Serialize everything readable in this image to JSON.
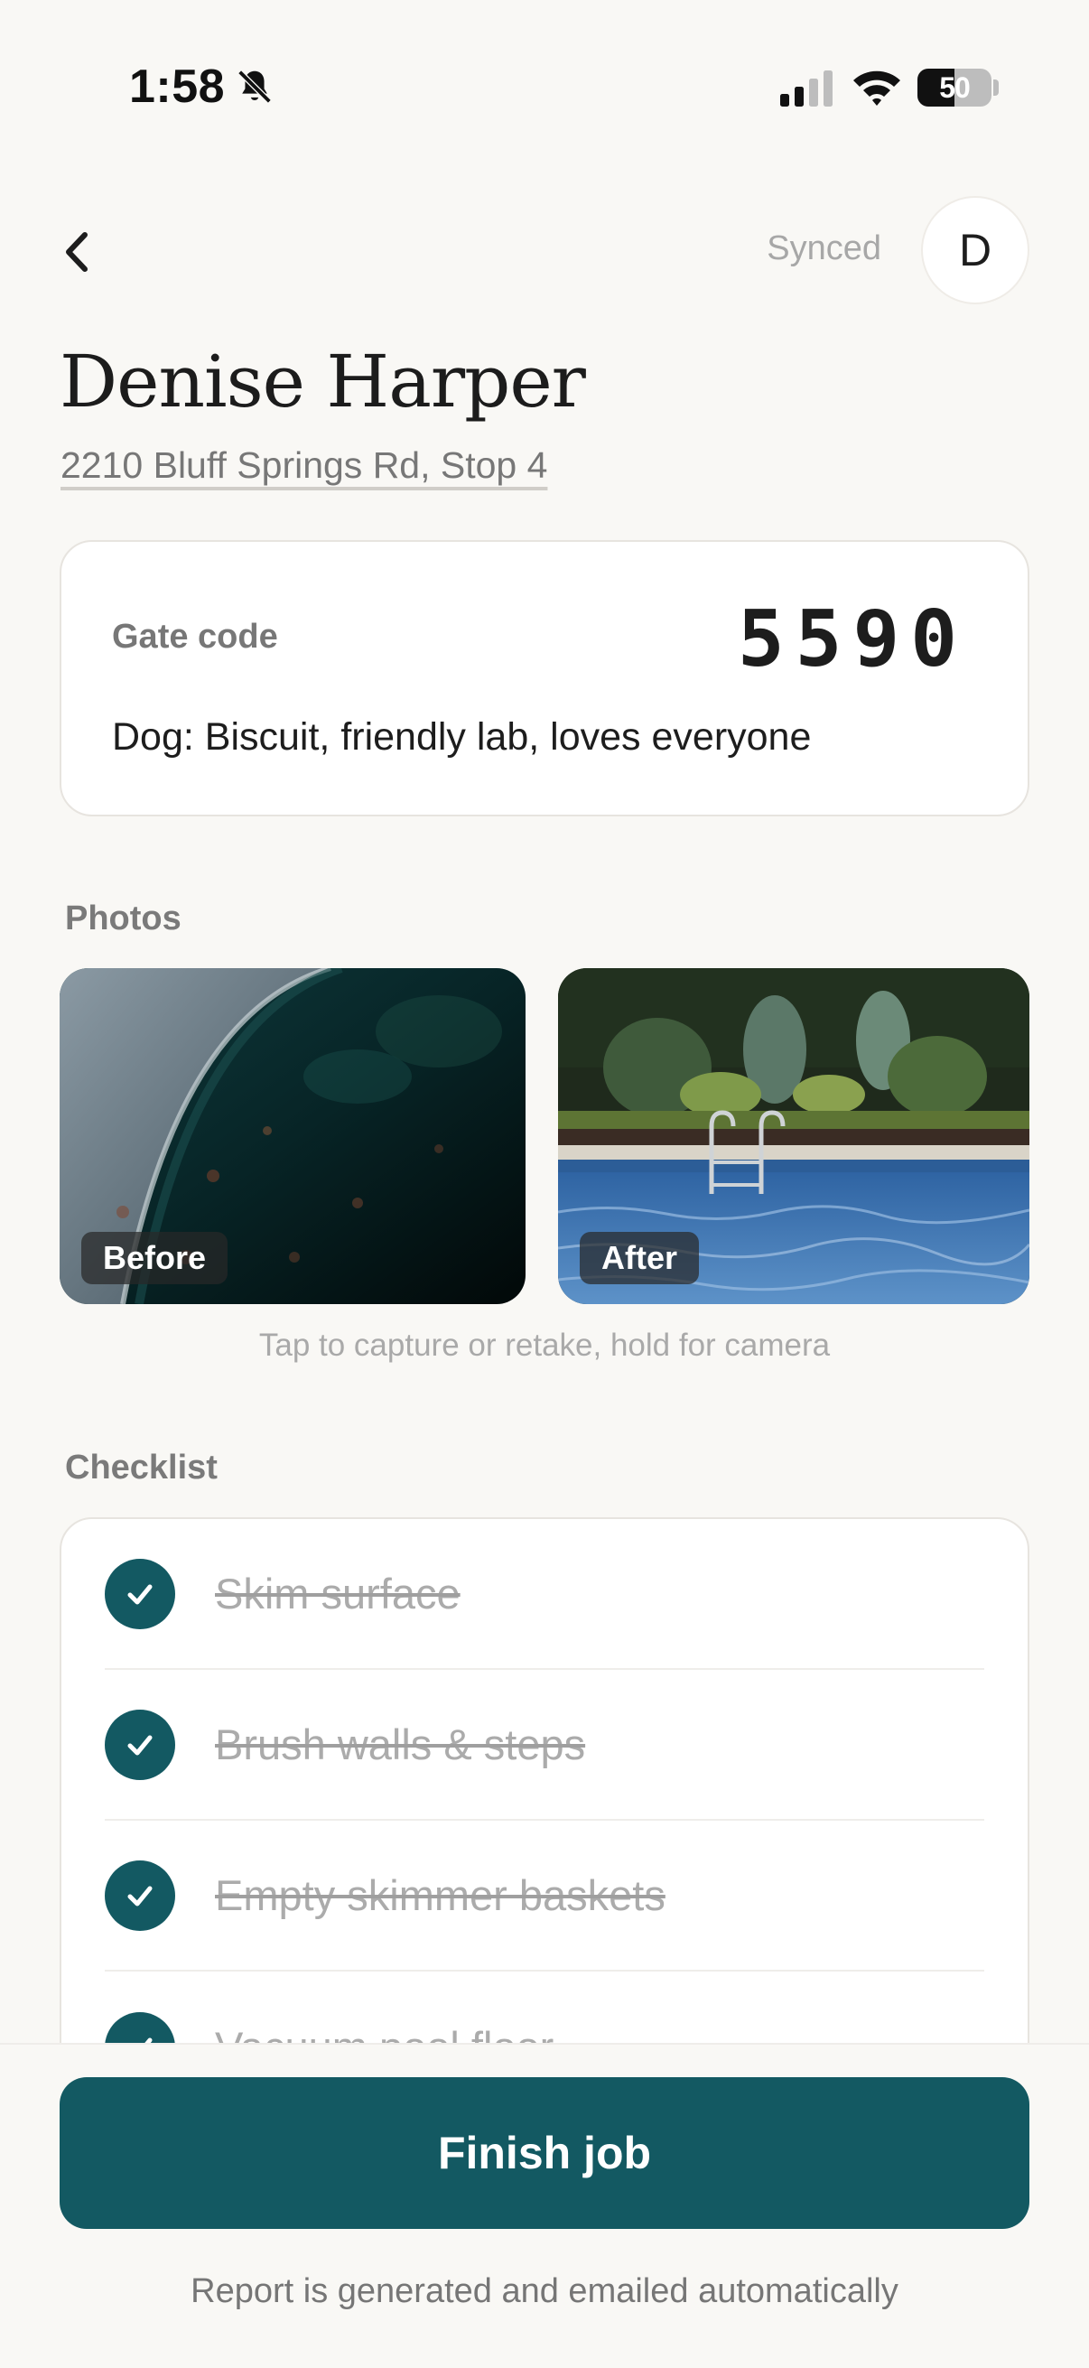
{
  "status_bar": {
    "time": "1:58",
    "battery": "50",
    "battery_fraction": 0.5
  },
  "header": {
    "back_icon": "chevron-left-icon",
    "sync_status": "Synced",
    "avatar_initial": "D"
  },
  "customer": {
    "name": "Denise Harper",
    "address": "2210 Bluff Springs Rd, Stop 4"
  },
  "gate": {
    "label": "Gate code",
    "code": "5590",
    "note": "Dog: Biscuit, friendly lab, loves everyone"
  },
  "photos": {
    "title": "Photos",
    "before_label": "Before",
    "after_label": "After",
    "hint": "Tap to capture or retake, hold for camera"
  },
  "checklist": {
    "title": "Checklist",
    "items": [
      {
        "label": "Skim surface",
        "done": true
      },
      {
        "label": "Brush walls & steps",
        "done": true
      },
      {
        "label": "Empty skimmer baskets",
        "done": true
      },
      {
        "label": "Vacuum pool floor",
        "done": true
      }
    ]
  },
  "footer": {
    "finish_label": "Finish job",
    "note": "Report is generated and emailed automatically"
  },
  "colors": {
    "accent": "#135962",
    "background": "#f9f8f5"
  }
}
